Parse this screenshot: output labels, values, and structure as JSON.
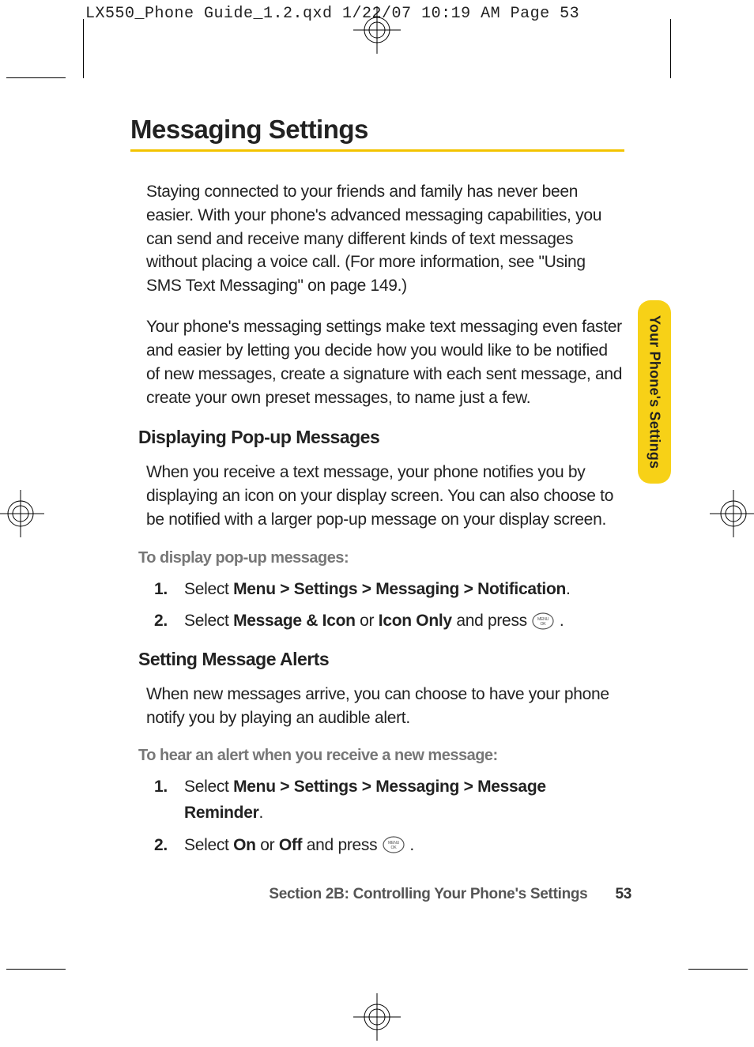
{
  "header_slug": "LX550_Phone Guide_1.2.qxd  1/22/07  10:19 AM  Page 53",
  "section_title": "Messaging Settings",
  "intro_para_1": "Staying connected to your friends and family has never been easier. With your phone's advanced messaging capabilities, you can send and receive many different kinds of text messages without placing a voice call. (For more information, see \"Using SMS Text Messaging\" on page 149.)",
  "intro_para_2": "Your phone's messaging settings make text messaging even faster and easier by letting you decide how you would like to be notified of new messages, create a signature with each sent message, and create your own preset messages, to name just a few.",
  "popup": {
    "heading": "Displaying Pop-up Messages",
    "body": "When you receive a text message, your phone notifies you by displaying an icon on your display screen. You can also choose to be notified with a larger pop-up message on your display screen.",
    "instruction_label": "To display pop-up messages:",
    "steps": [
      {
        "num": "1.",
        "prefix": "Select ",
        "bold": "Menu > Settings > Messaging > Notification",
        "suffix": "."
      },
      {
        "num": "2.",
        "prefix": "Select ",
        "bold1": "Message & Icon",
        "mid": " or ",
        "bold2": "Icon Only",
        "suffix": " and press ",
        "has_icon": true,
        "tail": " ."
      }
    ]
  },
  "alerts": {
    "heading": "Setting Message Alerts",
    "body": "When new messages arrive, you can choose to have your phone notify you by playing an audible alert.",
    "instruction_label": "To hear an alert when you receive a new message:",
    "steps": [
      {
        "num": "1.",
        "prefix": "Select ",
        "bold": "Menu > Settings > Messaging > Message Reminder",
        "suffix": "."
      },
      {
        "num": "2.",
        "prefix": "Select ",
        "bold1": "On",
        "mid": " or ",
        "bold2": "Off",
        "suffix": " and press ",
        "has_icon": true,
        "tail": " ."
      }
    ]
  },
  "side_tab": "Your Phone's Settings",
  "footer_text": "Section 2B: Controlling Your Phone's Settings",
  "page_number": "53",
  "icons": {
    "menu_ok": "MENU/OK key"
  }
}
